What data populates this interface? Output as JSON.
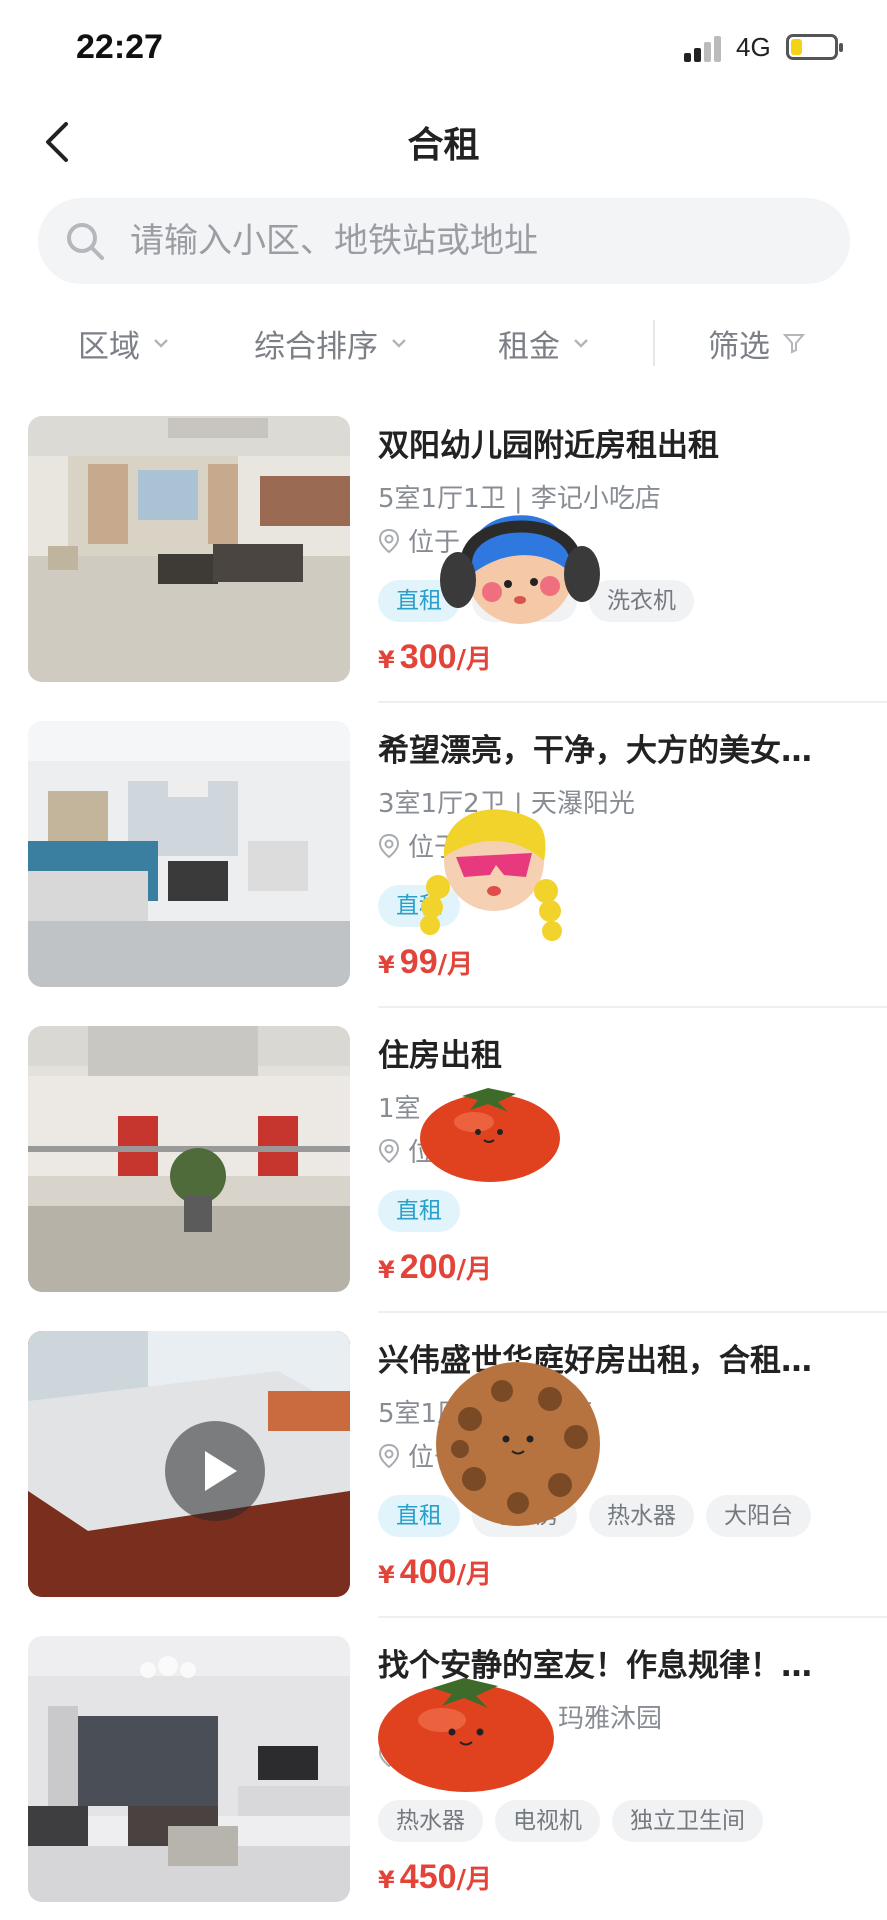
{
  "status_bar": {
    "time": "22:27",
    "network": "4G",
    "battery_level": 0.25
  },
  "nav": {
    "title": "合租"
  },
  "search": {
    "placeholder": "请输入小区、地铁站或地址"
  },
  "filters": [
    "区域",
    "综合排序",
    "租金",
    "筛选"
  ],
  "listings": [
    {
      "title": "双阳幼儿园附近房租出租",
      "spec": "5室1厅1卫 | 李记小吃店",
      "location": "位于",
      "tags": [
        "直租",
        "热水器",
        "洗衣机"
      ],
      "price_symbol": "¥",
      "price": "300",
      "unit": "/月"
    },
    {
      "title": "希望漂亮，干净，大方的美女…",
      "spec": "3室1厅2卫 | 天瀑阳光",
      "location": "位于",
      "tags": [
        "直租"
      ],
      "price_symbol": "¥",
      "price": "99",
      "unit": "/月"
    },
    {
      "title": "住房出租",
      "spec": "1室",
      "location": "位于",
      "tags": [
        "直租"
      ],
      "price_symbol": "¥",
      "price": "200",
      "unit": "/月"
    },
    {
      "title": "兴伟盛世华庭好房出租，合租…",
      "spec": "5室1厅 | 盛世华庭",
      "location": "位于",
      "tags": [
        "直租",
        "电梯房",
        "热水器",
        "大阳台"
      ],
      "price_symbol": "¥",
      "price": "400",
      "unit": "/月",
      "has_video": true
    },
    {
      "title": "找个安静的室友！作息规律！…",
      "spec": "玛雅沐园",
      "location": "",
      "tags": [
        "热水器",
        "电视机",
        "独立卫生间"
      ],
      "price_symbol": "¥",
      "price": "450",
      "unit": "/月"
    }
  ],
  "colors": {
    "price": "#e2443a",
    "tag_primary_bg": "#e2f4fb",
    "tag_primary_text": "#2a9fc9",
    "search_bg": "#f3f4f6"
  }
}
